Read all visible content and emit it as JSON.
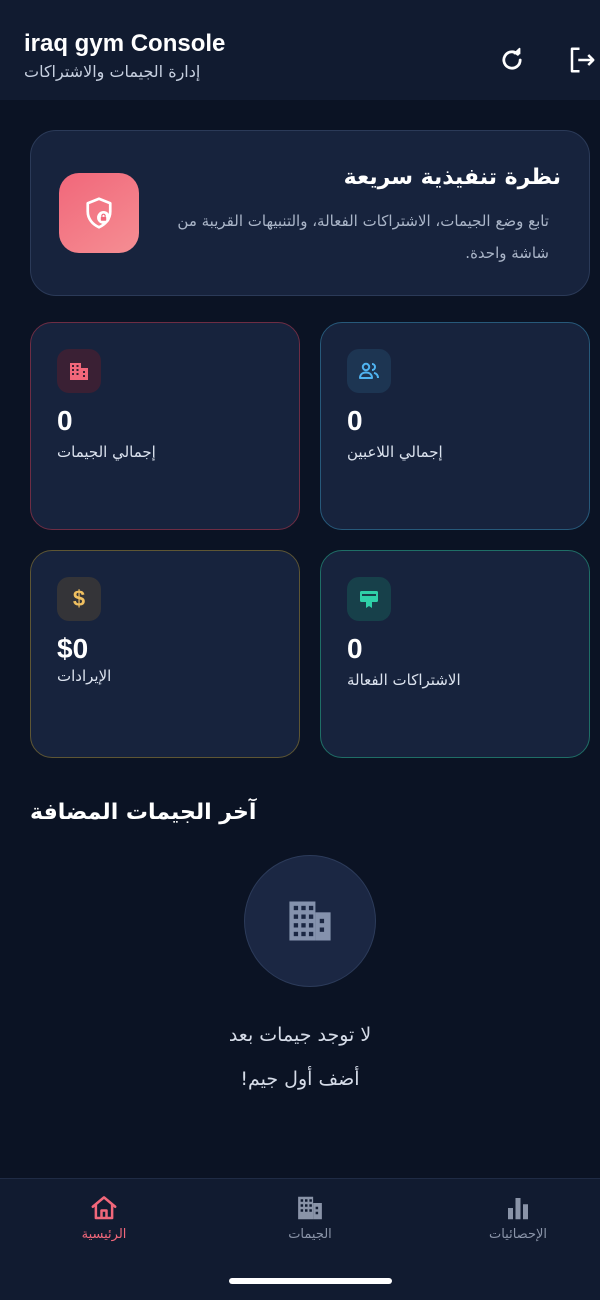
{
  "header": {
    "title": "iraq gym Console",
    "subtitle": "إدارة الجيمات والاشتراكات"
  },
  "overview": {
    "title": "نظرة تنفيذية سريعة",
    "description": "تابع وضع الجيمات، الاشتراكات الفعالة، والتنبيهات القريبة من شاشة واحدة."
  },
  "stats": [
    {
      "value": "0",
      "label": "إجمالي الجيمات",
      "icon": "building-icon",
      "color": "#f1677a"
    },
    {
      "value": "0",
      "label": "إجمالي اللاعبين",
      "icon": "users-icon",
      "color": "#4fb3f0"
    },
    {
      "value": "$0",
      "label": "الإيرادات",
      "icon": "dollar-icon",
      "color": "#f0c060"
    },
    {
      "value": "0",
      "label": "الاشتراكات الفعالة",
      "icon": "card-membership-icon",
      "color": "#2fd0a8"
    }
  ],
  "recent": {
    "title": "آخر الجيمات المضافة",
    "empty_line1": "لا توجد جيمات بعد",
    "empty_line2": "أضف أول جيم!"
  },
  "nav": {
    "items": [
      {
        "label": "الرئيسية",
        "icon": "home-icon",
        "active": true
      },
      {
        "label": "الجيمات",
        "icon": "building-icon",
        "active": false
      },
      {
        "label": "الإحصائيات",
        "icon": "bar-chart-icon",
        "active": false
      }
    ]
  },
  "colors": {
    "accent": "#f1677a",
    "background": "#0b1324",
    "card": "#17233d",
    "inactive_nav": "#8a94a8"
  }
}
